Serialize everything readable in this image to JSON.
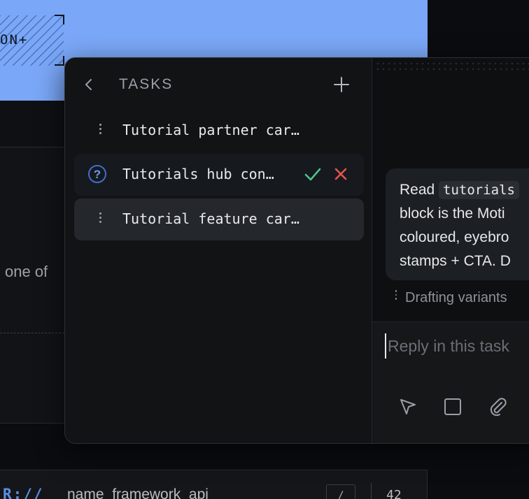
{
  "background": {
    "stamp_text": "ON+",
    "side_text": "one of",
    "code_prefix": "R://",
    "code_text": "name_framework_api",
    "code_key": "/",
    "code_number": "42"
  },
  "tasks_panel": {
    "title": "TASKS",
    "icons": {
      "back": "chevron-left-icon",
      "add": "plus-icon"
    },
    "items": [
      {
        "label": "Tutorial partner car…",
        "status": "menu",
        "icon": "vertical-dots-icon"
      },
      {
        "label": "Tutorials hub con…",
        "status": "needs-review",
        "icon": "question-circle-icon"
      },
      {
        "label": "Tutorial feature car…",
        "status": "selected",
        "icon": "vertical-dots-icon"
      }
    ]
  },
  "chat": {
    "message_lines": [
      "Read",
      "tutorials",
      "block is the Moti",
      "coloured, eyebro",
      "stamps + CTA. D"
    ],
    "status": "Drafting variants",
    "reply_placeholder": "Reply in this task",
    "tools": [
      "cursor-icon",
      "square-icon",
      "paperclip-icon"
    ]
  },
  "colors": {
    "accent_blue": "#7aa7f7",
    "approve_green": "#4cc38a",
    "reject_red": "#e5534b",
    "question_blue": "#3f6fcf"
  }
}
